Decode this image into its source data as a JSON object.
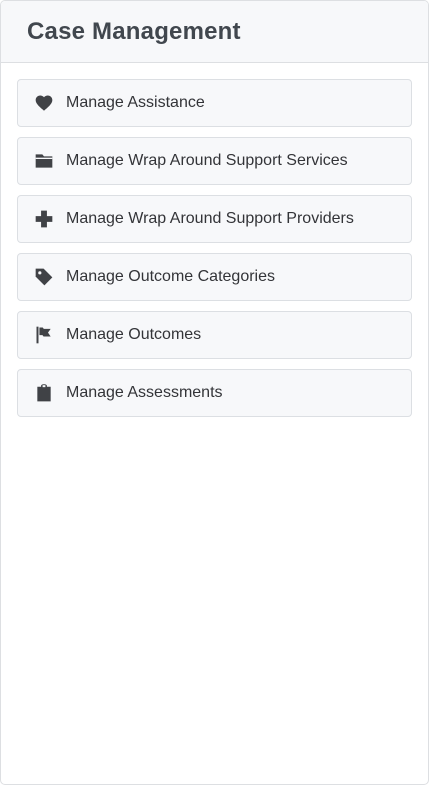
{
  "panel": {
    "title": "Case Management"
  },
  "menu": {
    "items": [
      {
        "label": "Manage Assistance",
        "icon": "heart-icon"
      },
      {
        "label": "Manage Wrap Around Support Services",
        "icon": "folder-icon"
      },
      {
        "label": "Manage Wrap Around Support Providers",
        "icon": "medical-cross-icon"
      },
      {
        "label": "Manage Outcome Categories",
        "icon": "tag-icon"
      },
      {
        "label": "Manage Outcomes",
        "icon": "flag-icon"
      },
      {
        "label": "Manage Assessments",
        "icon": "clipboard-icon"
      }
    ]
  },
  "colors": {
    "header_background": "#f7f8fa",
    "item_background": "#f7f8fa",
    "border": "#dcdfe3",
    "icon": "#404246",
    "title_text": "#41474e"
  }
}
